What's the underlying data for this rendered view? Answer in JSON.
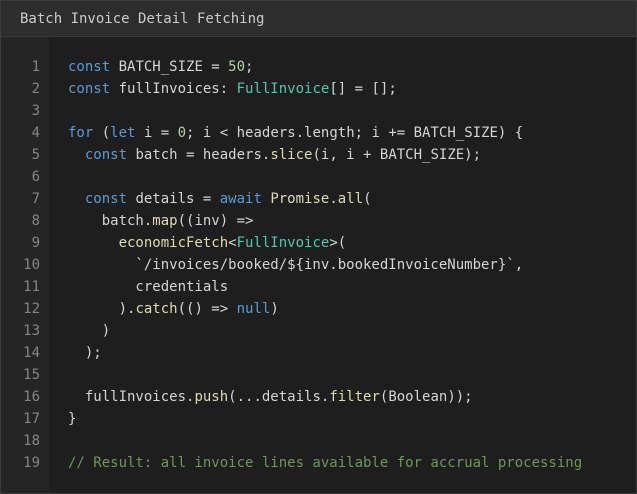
{
  "window": {
    "title": "Batch Invoice Detail Fetching"
  },
  "colors": {
    "background": "#1e1e1e",
    "title_bar": "#2d2d2d",
    "gutter": "#252526",
    "line_number": "#858585",
    "keyword": "#569cd6",
    "number": "#b5cea8",
    "type": "#4ec9b0",
    "function": "#dcdcaa",
    "comment": "#6a9955",
    "plain": "#d4d4d4"
  },
  "editor": {
    "lines": [
      {
        "number": "1",
        "tokens": [
          {
            "t": "kw",
            "v": "const"
          },
          {
            "t": "plain",
            "v": " BATCH_SIZE = "
          },
          {
            "t": "num",
            "v": "50"
          },
          {
            "t": "plain",
            "v": ";"
          }
        ]
      },
      {
        "number": "2",
        "tokens": [
          {
            "t": "kw",
            "v": "const"
          },
          {
            "t": "plain",
            "v": " fullInvoices: "
          },
          {
            "t": "type",
            "v": "FullInvoice"
          },
          {
            "t": "plain",
            "v": "[] = [];"
          }
        ]
      },
      {
        "number": "3",
        "tokens": []
      },
      {
        "number": "4",
        "tokens": [
          {
            "t": "kw",
            "v": "for"
          },
          {
            "t": "plain",
            "v": " ("
          },
          {
            "t": "kw",
            "v": "let"
          },
          {
            "t": "plain",
            "v": " i = "
          },
          {
            "t": "num",
            "v": "0"
          },
          {
            "t": "plain",
            "v": "; i < headers.length; i += BATCH_SIZE) {"
          }
        ]
      },
      {
        "number": "5",
        "tokens": [
          {
            "t": "plain",
            "v": "  "
          },
          {
            "t": "kw",
            "v": "const"
          },
          {
            "t": "plain",
            "v": " batch = headers."
          },
          {
            "t": "fn",
            "v": "slice"
          },
          {
            "t": "plain",
            "v": "(i, i + BATCH_SIZE);"
          }
        ]
      },
      {
        "number": "6",
        "tokens": []
      },
      {
        "number": "7",
        "tokens": [
          {
            "t": "plain",
            "v": "  "
          },
          {
            "t": "kw",
            "v": "const"
          },
          {
            "t": "plain",
            "v": " details = "
          },
          {
            "t": "kw",
            "v": "await"
          },
          {
            "t": "plain",
            "v": " "
          },
          {
            "t": "fn",
            "v": "Promise"
          },
          {
            "t": "plain",
            "v": "."
          },
          {
            "t": "fn",
            "v": "all"
          },
          {
            "t": "plain",
            "v": "("
          }
        ]
      },
      {
        "number": "8",
        "tokens": [
          {
            "t": "plain",
            "v": "    batch."
          },
          {
            "t": "fn",
            "v": "map"
          },
          {
            "t": "plain",
            "v": "((inv) =>"
          }
        ]
      },
      {
        "number": "9",
        "tokens": [
          {
            "t": "plain",
            "v": "      "
          },
          {
            "t": "fn",
            "v": "economicFetch"
          },
          {
            "t": "plain",
            "v": "<"
          },
          {
            "t": "type",
            "v": "FullInvoice"
          },
          {
            "t": "plain",
            "v": ">("
          }
        ]
      },
      {
        "number": "10",
        "tokens": [
          {
            "t": "plain",
            "v": "        `/invoices/booked/${inv.bookedInvoiceNumber}`,"
          }
        ]
      },
      {
        "number": "11",
        "tokens": [
          {
            "t": "plain",
            "v": "        credentials"
          }
        ]
      },
      {
        "number": "12",
        "tokens": [
          {
            "t": "plain",
            "v": "      )."
          },
          {
            "t": "fn",
            "v": "catch"
          },
          {
            "t": "plain",
            "v": "(() => "
          },
          {
            "t": "kw",
            "v": "null"
          },
          {
            "t": "plain",
            "v": ")"
          }
        ]
      },
      {
        "number": "13",
        "tokens": [
          {
            "t": "plain",
            "v": "    )"
          }
        ]
      },
      {
        "number": "14",
        "tokens": [
          {
            "t": "plain",
            "v": "  );"
          }
        ]
      },
      {
        "number": "15",
        "tokens": []
      },
      {
        "number": "16",
        "tokens": [
          {
            "t": "plain",
            "v": "  fullInvoices."
          },
          {
            "t": "fn",
            "v": "push"
          },
          {
            "t": "plain",
            "v": "(...details."
          },
          {
            "t": "fn",
            "v": "filter"
          },
          {
            "t": "plain",
            "v": "(Boolean));"
          }
        ]
      },
      {
        "number": "17",
        "tokens": [
          {
            "t": "plain",
            "v": "}"
          }
        ]
      },
      {
        "number": "18",
        "tokens": []
      },
      {
        "number": "19",
        "tokens": [
          {
            "t": "comment",
            "v": "// Result: all invoice lines available for accrual processing"
          }
        ]
      }
    ]
  }
}
